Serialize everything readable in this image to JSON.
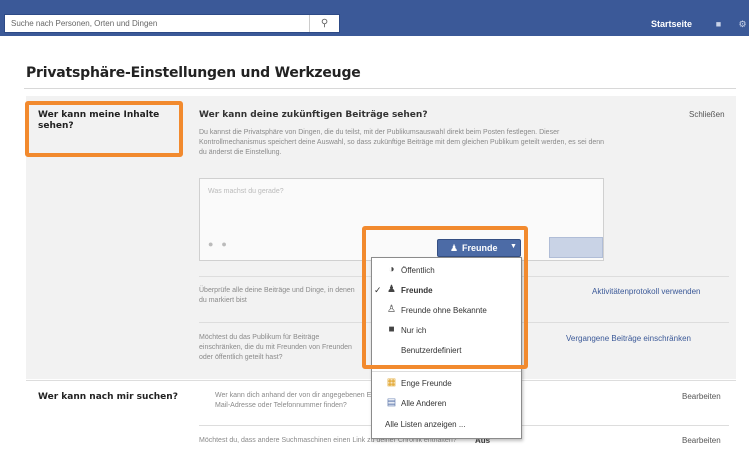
{
  "topbar": {
    "search_placeholder": "Suche nach Personen, Orten und Dingen",
    "search_icon": "magnifier-icon",
    "home_label": "Startseite",
    "colors": {
      "bar": "#3b5998",
      "highlight": "#f28a2e"
    }
  },
  "page": {
    "title": "Privatsphäre-Einstellungen und Werkzeuge"
  },
  "section_content": {
    "label": "Wer kann meine Inhalte sehen?",
    "question": "Wer kann deine zukünftigen Beiträge sehen?",
    "close_link": "Schließen",
    "description": "Du kannst die Privatsphäre von Dingen, die du teilst, mit der Publikumsauswahl direkt beim Posten festlegen. Dieser Kontrollmechanismus speichert deine Auswahl, so dass zukünftige Beiträge mit dem gleichen Publikum geteilt werden, es sei denn du änderst die Einstellung.",
    "composer_placeholder": "Was machst du gerade?",
    "audience_button": "Freunde",
    "row2_text": "Überprüfe alle deine Beiträge und Dinge, in denen du markiert bist",
    "row2_link": "Aktivitätenprotokoll verwenden",
    "row3_text": "Möchtest du das Publikum für Beiträge einschränken, die du mit Freunden von Freunden oder öffentlich geteilt hast?",
    "row3_link": "Vergangene Beiträge einschränken"
  },
  "audience_menu": {
    "items": [
      {
        "label": "Öffentlich",
        "icon": "globe-icon",
        "checked": false
      },
      {
        "label": "Freunde",
        "icon": "friends-icon",
        "checked": true
      },
      {
        "label": "Freunde ohne Bekannte",
        "icon": "friends-except-icon",
        "checked": false
      },
      {
        "label": "Nur ich",
        "icon": "lock-icon",
        "checked": false
      },
      {
        "label": "Benutzerdefiniert",
        "icon": "",
        "checked": false
      },
      {
        "label": "Enge Freunde",
        "icon": "star-list-icon",
        "checked": false
      },
      {
        "label": "Alle Anderen",
        "icon": "list-icon",
        "checked": false
      },
      {
        "label": "Alle Listen anzeigen ...",
        "icon": "",
        "checked": false
      }
    ]
  },
  "section_search": {
    "label": "Wer kann nach mir suchen?",
    "row1_text": "Wer kann dich anhand der von dir angegebenen E-Mail-Adresse oder Telefonnummer finden?",
    "row1_link": "Bearbeiten",
    "row2_text": "Möchtest du, dass andere Suchmaschinen einen Link zu deiner Chronik enthalten?",
    "row2_value": "Aus",
    "row2_link": "Bearbeiten"
  }
}
